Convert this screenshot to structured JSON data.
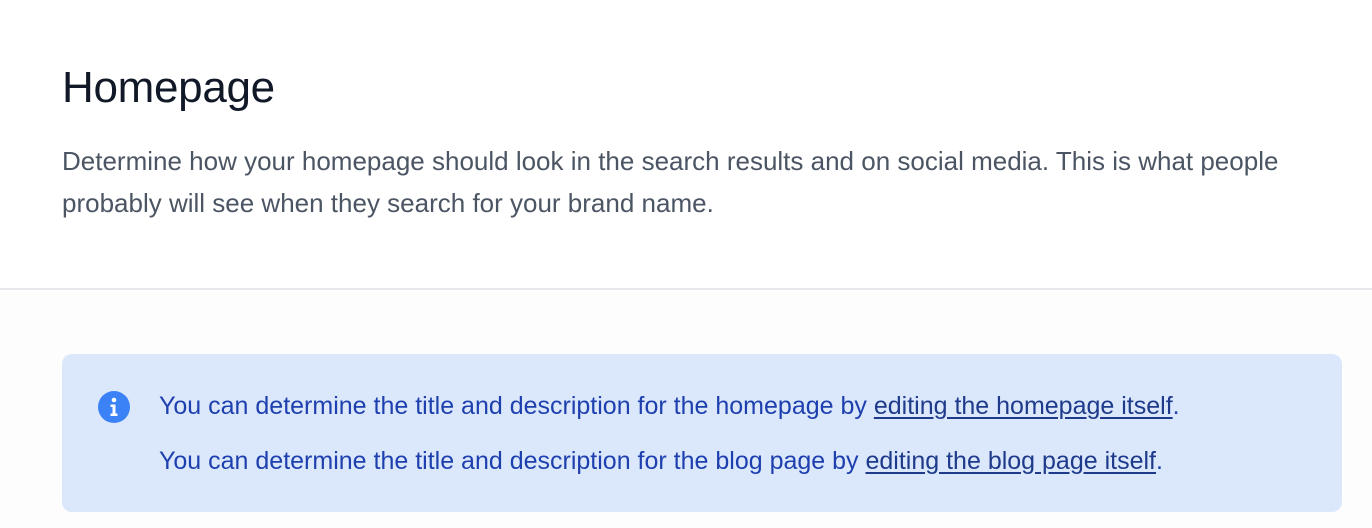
{
  "header": {
    "title": "Homepage",
    "description": "Determine how your homepage should look in the search results and on social media. This is what people probably will see when they search for your brand name."
  },
  "info_box": {
    "icon": "info-icon",
    "line1": {
      "text": "You can determine the title and description for the homepage by ",
      "link": "editing the homepage itself",
      "suffix": "."
    },
    "line2": {
      "text": "You can determine the title and description for the blog page by ",
      "link": "editing the blog page itself",
      "suffix": "."
    }
  },
  "colors": {
    "info_background": "#dbe8fc",
    "info_text": "#1e40af",
    "icon": "#3b82f6",
    "title": "#111827",
    "description": "#4b5563"
  }
}
